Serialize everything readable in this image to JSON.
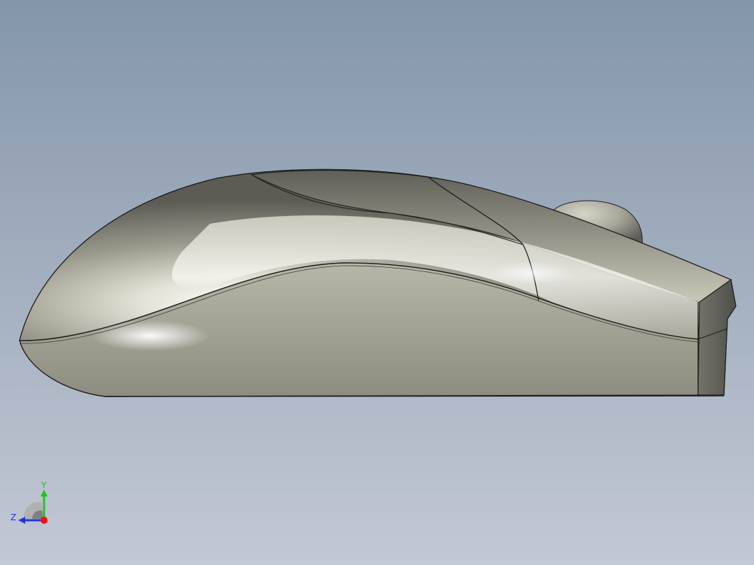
{
  "viewport": {
    "background_top": "#8496aa",
    "background_bottom": "#c3c8d5"
  },
  "model": {
    "name": "mouse",
    "body_color": "#b6b5a6",
    "edge_color": "#1e1e1e"
  },
  "triad": {
    "y_label": "Y",
    "z_label": "Z",
    "y_color": "#22c422",
    "z_color": "#2233dd",
    "x_color": "#ee1111"
  }
}
